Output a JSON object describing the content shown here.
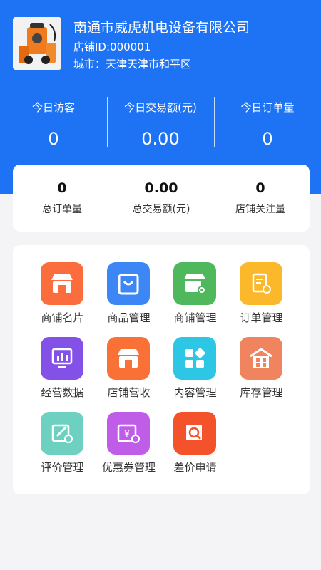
{
  "shop": {
    "name": "南通市威虎机电设备有限公司",
    "id_text": "店铺ID:000001",
    "city_text": "城市：天津天津市和平区"
  },
  "today_stats": [
    {
      "label": "今日访客",
      "value": "0"
    },
    {
      "label": "今日交易额(元)",
      "value": "0.00"
    },
    {
      "label": "今日订单量",
      "value": "0"
    }
  ],
  "total_stats": [
    {
      "label": "总订单量",
      "value": "0"
    },
    {
      "label": "总交易额(元)",
      "value": "0.00"
    },
    {
      "label": "店铺关注量",
      "value": "0"
    }
  ],
  "menu": [
    {
      "label": "商铺名片",
      "icon": "storefront-icon",
      "color": "#fb6d3c"
    },
    {
      "label": "商品管理",
      "icon": "shopping-bag-icon",
      "color": "#3c87f5"
    },
    {
      "label": "商铺管理",
      "icon": "store-settings-icon",
      "color": "#4fb85c"
    },
    {
      "label": "订单管理",
      "icon": "order-settings-icon",
      "color": "#fbb82a"
    },
    {
      "label": "经营数据",
      "icon": "bar-chart-monitor-icon",
      "color": "#8351e8"
    },
    {
      "label": "店铺营收",
      "icon": "store-revenue-icon",
      "color": "#f97137"
    },
    {
      "label": "内容管理",
      "icon": "grid-tiles-icon",
      "color": "#2dc7e5"
    },
    {
      "label": "库存管理",
      "icon": "warehouse-icon",
      "color": "#f0845e"
    },
    {
      "label": "评价管理",
      "icon": "edit-review-icon",
      "color": "#6dd0c1"
    },
    {
      "label": "优惠券管理",
      "icon": "coupon-yen-icon",
      "color": "#c05de8"
    },
    {
      "label": "差价申请",
      "icon": "price-search-icon",
      "color": "#f4522b"
    }
  ]
}
